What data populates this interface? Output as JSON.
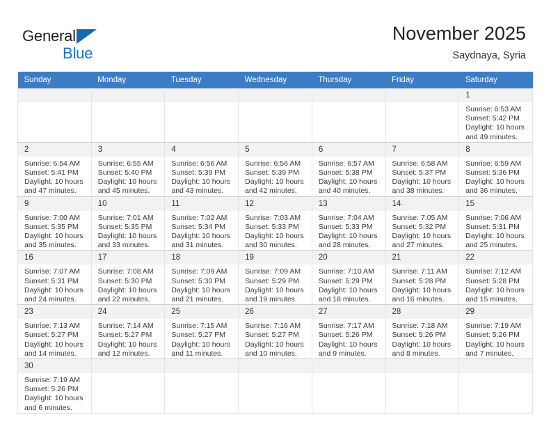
{
  "brand": {
    "word1": "General",
    "word2": "Blue",
    "flag_color": "#1668b3",
    "word2_color": "#1b75bb"
  },
  "header": {
    "title": "November 2025",
    "subtitle": "Saydnaya, Syria"
  },
  "theme": {
    "header_bg": "#3b7dc4",
    "header_text": "#ffffff",
    "daynum_bg": "#f2f2f2",
    "cell_text": "#3a3a3a"
  },
  "weekdays": [
    "Sunday",
    "Monday",
    "Tuesday",
    "Wednesday",
    "Thursday",
    "Friday",
    "Saturday"
  ],
  "weeks": [
    [
      {
        "day": "",
        "lines": []
      },
      {
        "day": "",
        "lines": []
      },
      {
        "day": "",
        "lines": []
      },
      {
        "day": "",
        "lines": []
      },
      {
        "day": "",
        "lines": []
      },
      {
        "day": "",
        "lines": []
      },
      {
        "day": "1",
        "lines": [
          "Sunrise: 6:53 AM",
          "Sunset: 5:42 PM",
          "Daylight: 10 hours",
          "and 49 minutes."
        ]
      }
    ],
    [
      {
        "day": "2",
        "lines": [
          "Sunrise: 6:54 AM",
          "Sunset: 5:41 PM",
          "Daylight: 10 hours",
          "and 47 minutes."
        ]
      },
      {
        "day": "3",
        "lines": [
          "Sunrise: 6:55 AM",
          "Sunset: 5:40 PM",
          "Daylight: 10 hours",
          "and 45 minutes."
        ]
      },
      {
        "day": "4",
        "lines": [
          "Sunrise: 6:56 AM",
          "Sunset: 5:39 PM",
          "Daylight: 10 hours",
          "and 43 minutes."
        ]
      },
      {
        "day": "5",
        "lines": [
          "Sunrise: 6:56 AM",
          "Sunset: 5:39 PM",
          "Daylight: 10 hours",
          "and 42 minutes."
        ]
      },
      {
        "day": "6",
        "lines": [
          "Sunrise: 6:57 AM",
          "Sunset: 5:38 PM",
          "Daylight: 10 hours",
          "and 40 minutes."
        ]
      },
      {
        "day": "7",
        "lines": [
          "Sunrise: 6:58 AM",
          "Sunset: 5:37 PM",
          "Daylight: 10 hours",
          "and 38 minutes."
        ]
      },
      {
        "day": "8",
        "lines": [
          "Sunrise: 6:59 AM",
          "Sunset: 5:36 PM",
          "Daylight: 10 hours",
          "and 36 minutes."
        ]
      }
    ],
    [
      {
        "day": "9",
        "lines": [
          "Sunrise: 7:00 AM",
          "Sunset: 5:35 PM",
          "Daylight: 10 hours",
          "and 35 minutes."
        ]
      },
      {
        "day": "10",
        "lines": [
          "Sunrise: 7:01 AM",
          "Sunset: 5:35 PM",
          "Daylight: 10 hours",
          "and 33 minutes."
        ]
      },
      {
        "day": "11",
        "lines": [
          "Sunrise: 7:02 AM",
          "Sunset: 5:34 PM",
          "Daylight: 10 hours",
          "and 31 minutes."
        ]
      },
      {
        "day": "12",
        "lines": [
          "Sunrise: 7:03 AM",
          "Sunset: 5:33 PM",
          "Daylight: 10 hours",
          "and 30 minutes."
        ]
      },
      {
        "day": "13",
        "lines": [
          "Sunrise: 7:04 AM",
          "Sunset: 5:33 PM",
          "Daylight: 10 hours",
          "and 28 minutes."
        ]
      },
      {
        "day": "14",
        "lines": [
          "Sunrise: 7:05 AM",
          "Sunset: 5:32 PM",
          "Daylight: 10 hours",
          "and 27 minutes."
        ]
      },
      {
        "day": "15",
        "lines": [
          "Sunrise: 7:06 AM",
          "Sunset: 5:31 PM",
          "Daylight: 10 hours",
          "and 25 minutes."
        ]
      }
    ],
    [
      {
        "day": "16",
        "lines": [
          "Sunrise: 7:07 AM",
          "Sunset: 5:31 PM",
          "Daylight: 10 hours",
          "and 24 minutes."
        ]
      },
      {
        "day": "17",
        "lines": [
          "Sunrise: 7:08 AM",
          "Sunset: 5:30 PM",
          "Daylight: 10 hours",
          "and 22 minutes."
        ]
      },
      {
        "day": "18",
        "lines": [
          "Sunrise: 7:09 AM",
          "Sunset: 5:30 PM",
          "Daylight: 10 hours",
          "and 21 minutes."
        ]
      },
      {
        "day": "19",
        "lines": [
          "Sunrise: 7:09 AM",
          "Sunset: 5:29 PM",
          "Daylight: 10 hours",
          "and 19 minutes."
        ]
      },
      {
        "day": "20",
        "lines": [
          "Sunrise: 7:10 AM",
          "Sunset: 5:29 PM",
          "Daylight: 10 hours",
          "and 18 minutes."
        ]
      },
      {
        "day": "21",
        "lines": [
          "Sunrise: 7:11 AM",
          "Sunset: 5:28 PM",
          "Daylight: 10 hours",
          "and 16 minutes."
        ]
      },
      {
        "day": "22",
        "lines": [
          "Sunrise: 7:12 AM",
          "Sunset: 5:28 PM",
          "Daylight: 10 hours",
          "and 15 minutes."
        ]
      }
    ],
    [
      {
        "day": "23",
        "lines": [
          "Sunrise: 7:13 AM",
          "Sunset: 5:27 PM",
          "Daylight: 10 hours",
          "and 14 minutes."
        ]
      },
      {
        "day": "24",
        "lines": [
          "Sunrise: 7:14 AM",
          "Sunset: 5:27 PM",
          "Daylight: 10 hours",
          "and 12 minutes."
        ]
      },
      {
        "day": "25",
        "lines": [
          "Sunrise: 7:15 AM",
          "Sunset: 5:27 PM",
          "Daylight: 10 hours",
          "and 11 minutes."
        ]
      },
      {
        "day": "26",
        "lines": [
          "Sunrise: 7:16 AM",
          "Sunset: 5:27 PM",
          "Daylight: 10 hours",
          "and 10 minutes."
        ]
      },
      {
        "day": "27",
        "lines": [
          "Sunrise: 7:17 AM",
          "Sunset: 5:26 PM",
          "Daylight: 10 hours",
          "and 9 minutes."
        ]
      },
      {
        "day": "28",
        "lines": [
          "Sunrise: 7:18 AM",
          "Sunset: 5:26 PM",
          "Daylight: 10 hours",
          "and 8 minutes."
        ]
      },
      {
        "day": "29",
        "lines": [
          "Sunrise: 7:19 AM",
          "Sunset: 5:26 PM",
          "Daylight: 10 hours",
          "and 7 minutes."
        ]
      }
    ],
    [
      {
        "day": "30",
        "lines": [
          "Sunrise: 7:19 AM",
          "Sunset: 5:26 PM",
          "Daylight: 10 hours",
          "and 6 minutes."
        ]
      },
      {
        "day": "",
        "lines": []
      },
      {
        "day": "",
        "lines": []
      },
      {
        "day": "",
        "lines": []
      },
      {
        "day": "",
        "lines": []
      },
      {
        "day": "",
        "lines": []
      },
      {
        "day": "",
        "lines": []
      }
    ]
  ]
}
